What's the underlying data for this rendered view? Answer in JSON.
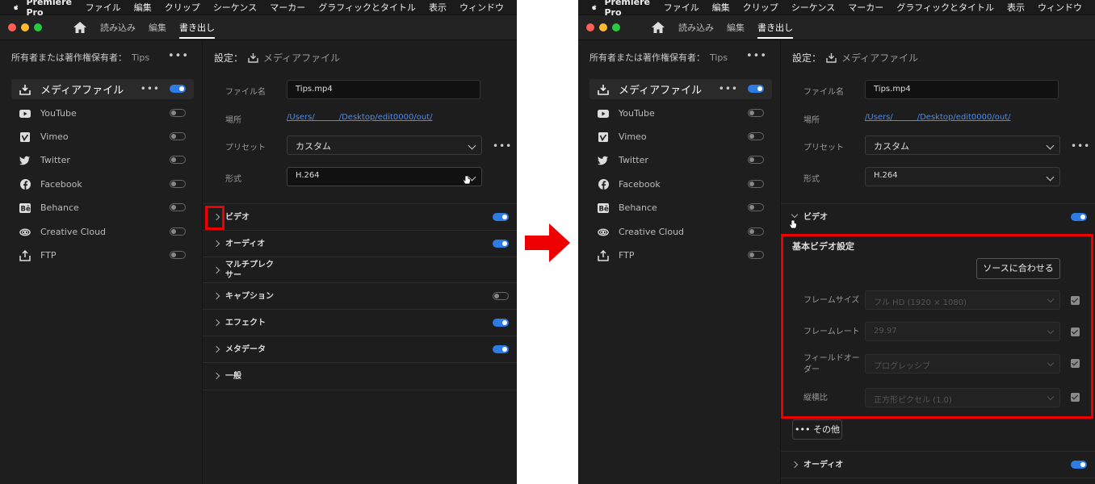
{
  "menubar": {
    "app_name": "Premiere Pro",
    "items": [
      "ファイル",
      "編集",
      "クリップ",
      "シーケンス",
      "マーカー",
      "グラフィックとタイトル",
      "表示",
      "ウィンドウ"
    ]
  },
  "tabs": {
    "import": "読み込み",
    "edit": "編集",
    "export": "書き出し"
  },
  "owner": {
    "label": "所有者または著作権保有者：",
    "value": "Tips",
    "more": "•••"
  },
  "destinations": [
    {
      "label": "メディアファイル",
      "icon": "download-icon",
      "on": true
    },
    {
      "label": "YouTube",
      "icon": "youtube-icon",
      "on": false
    },
    {
      "label": "Vimeo",
      "icon": "vimeo-icon",
      "on": false
    },
    {
      "label": "Twitter",
      "icon": "twitter-icon",
      "on": false
    },
    {
      "label": "Facebook",
      "icon": "facebook-icon",
      "on": false
    },
    {
      "label": "Behance",
      "icon": "behance-icon",
      "on": false
    },
    {
      "label": "Creative Cloud",
      "icon": "creative-cloud-icon",
      "on": false
    },
    {
      "label": "FTP",
      "icon": "upload-icon",
      "on": false
    }
  ],
  "settings": {
    "title": "設定：",
    "destination": "メディアファイル",
    "filename_label": "ファイル名",
    "filename": "Tips.mp4",
    "location_label": "場所",
    "location": "/Users/      /Desktop/edit0000/out/",
    "preset_label": "プリセット",
    "preset": "カスタム",
    "format_label": "形式",
    "format": "H.264",
    "more": "•••"
  },
  "sections_before": [
    {
      "label": "ビデオ",
      "toggle": true
    },
    {
      "label": "オーディオ",
      "toggle": true
    },
    {
      "label": "マルチプレクサー",
      "toggle": null
    },
    {
      "label": "キャプション",
      "toggle": false
    },
    {
      "label": "エフェクト",
      "toggle": true
    },
    {
      "label": "メタデータ",
      "toggle": true
    },
    {
      "label": "一般",
      "toggle": null
    }
  ],
  "video_basic": {
    "title": "基本ビデオ設定",
    "match_source": "ソースに合わせる",
    "rows": [
      {
        "label": "フレームサイズ",
        "value": "フル HD (1920 × 1080)"
      },
      {
        "label": "フレームレート",
        "value": "29.97"
      },
      {
        "label": "フィールドオーダー",
        "value": "プログレッシブ"
      },
      {
        "label": "縦横比",
        "value": "正方形ピクセル (1.0)"
      }
    ],
    "other": "••• その他",
    "after_section": "オーディオ"
  },
  "colors": {
    "accent": "#2d7be5",
    "highlight": "#e00000",
    "arrow": "#ee0000",
    "link": "#4a8cf0"
  }
}
